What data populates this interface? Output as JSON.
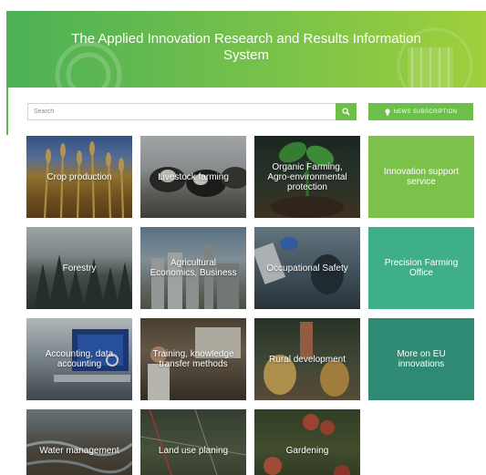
{
  "header": {
    "title": "The Applied Innovation Research and Results Information System"
  },
  "search": {
    "placeholder": "Search"
  },
  "news_button": {
    "label": "NEWS SUBSCRIPTION"
  },
  "tiles": [
    {
      "label": "Crop production"
    },
    {
      "label": "Livestock farming"
    },
    {
      "label": "Organic Farming, Agro-environmental protection"
    },
    {
      "label": "Innovation support service"
    },
    {
      "label": "Forestry"
    },
    {
      "label": "Agricultural Economics, Business"
    },
    {
      "label": "Occupational Safety"
    },
    {
      "label": "Precision Farming Office"
    },
    {
      "label": "Accounting, data accounting"
    },
    {
      "label": "Training, knowledge transfer methods"
    },
    {
      "label": "Rural development"
    },
    {
      "label": "More on EU innovations"
    },
    {
      "label": "Water management"
    },
    {
      "label": "Land use planing"
    },
    {
      "label": "Gardening"
    }
  ],
  "colors": {
    "brand_green": "#6cc04a",
    "innovation_tile": "#7cc24a",
    "precision_tile": "#3fae8a",
    "eu_tile": "#2e8a72"
  }
}
